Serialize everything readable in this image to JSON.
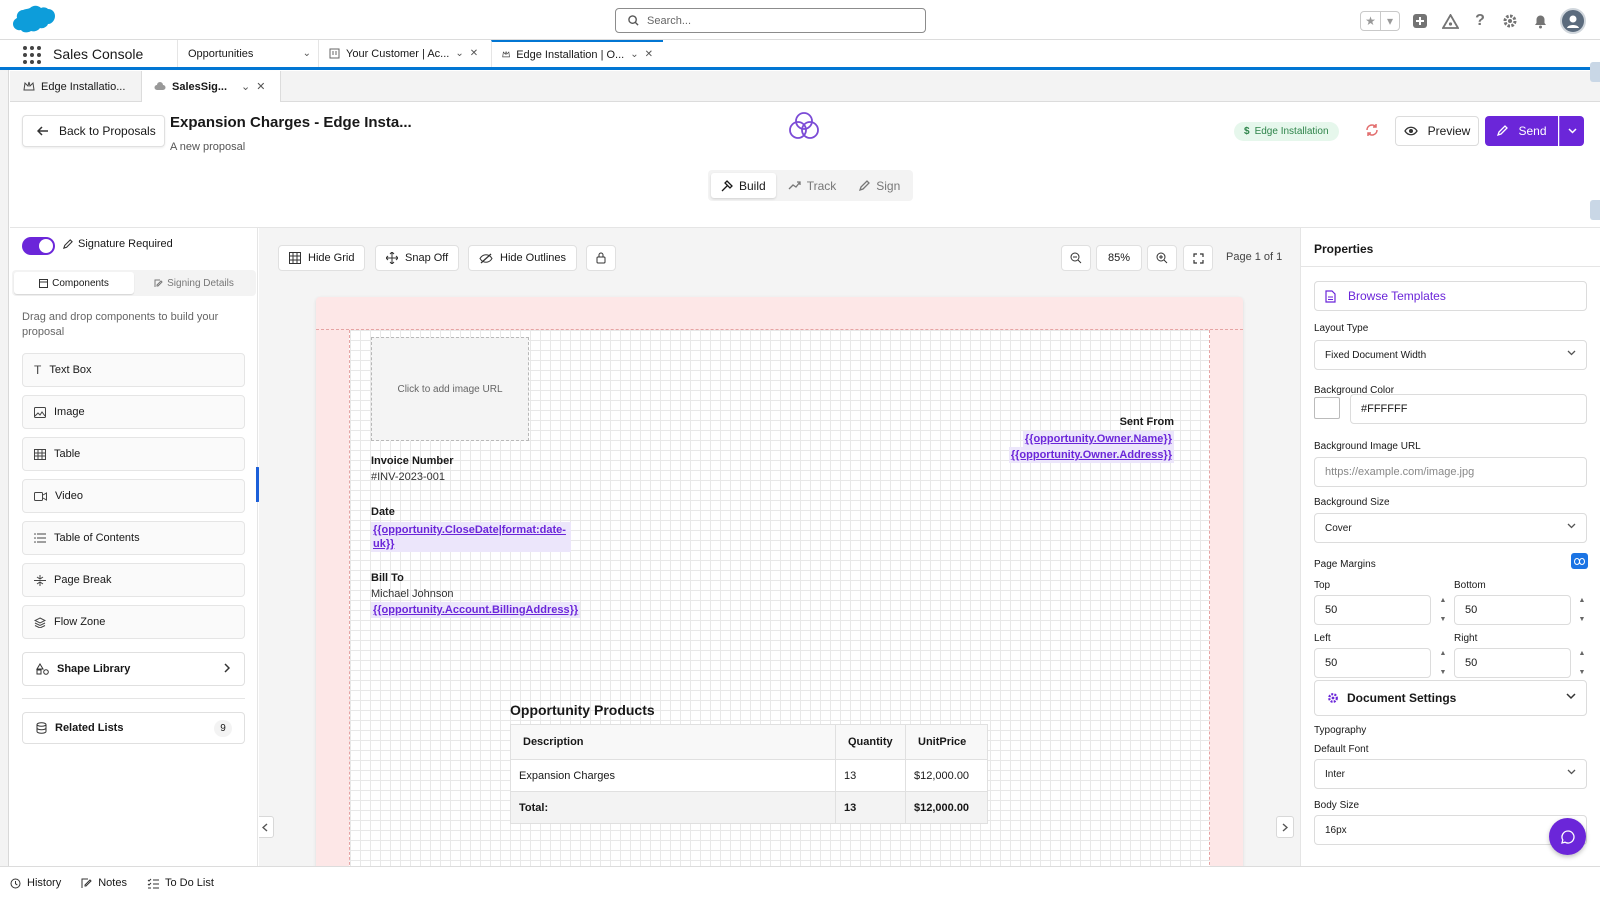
{
  "header": {
    "search_placeholder": "Search..."
  },
  "nav": {
    "app_name": "Sales Console",
    "object_tab": "Opportunities",
    "tabs": [
      {
        "label": "Your Customer | Ac..."
      },
      {
        "label": "Edge Installation | O..."
      }
    ]
  },
  "subtabs": [
    {
      "label": "Edge Installatio..."
    },
    {
      "label": "SalesSig..."
    }
  ],
  "proposal": {
    "back_label": "Back to Proposals",
    "title": "Expansion Charges - Edge Insta...",
    "subtitle": "A new proposal",
    "opportunity_badge": "Edge Installation",
    "preview_label": "Preview",
    "send_label": "Send",
    "modes": [
      "Build",
      "Track",
      "Sign"
    ]
  },
  "left_panel": {
    "signature_label": "Signature Required",
    "signature_required": true,
    "tabs": [
      "Components",
      "Signing Details"
    ],
    "hint": "Drag and drop components to build your proposal",
    "components": [
      "Text Box",
      "Image",
      "Table",
      "Video",
      "Table of Contents",
      "Page Break",
      "Flow Zone"
    ],
    "shape_library": "Shape Library",
    "related_lists": "Related Lists",
    "related_count": "9"
  },
  "toolbar": {
    "hide_grid": "Hide Grid",
    "snap": "Snap Off",
    "hide_outlines": "Hide Outlines",
    "zoom": "85%",
    "page": "Page 1 of 1"
  },
  "document": {
    "image_placeholder": "Click to add image URL",
    "sent_from_label": "Sent From",
    "owner_name": "{{opportunity.Owner.Name}}",
    "owner_address": "{{opportunity.Owner.Address}}",
    "invoice_label": "Invoice Number",
    "invoice_value": "#INV-2023-001",
    "date_label": "Date",
    "date_value": "{{opportunity.CloseDate|format:date-uk}}",
    "bill_label": "Bill To",
    "bill_name": "Michael Johnson",
    "bill_address": "{{opportunity.Account.BillingAddress}}",
    "products_title": "Opportunity Products",
    "table": {
      "headers": [
        "Description",
        "Quantity",
        "UnitPrice"
      ],
      "rows": [
        [
          "Expansion Charges",
          "13",
          "$12,000.00"
        ]
      ],
      "total": [
        "Total:",
        "13",
        "$12,000.00"
      ]
    }
  },
  "properties": {
    "title": "Properties",
    "browse": "Browse Templates",
    "layout_label": "Layout Type",
    "layout_value": "Fixed Document Width",
    "bg_color_label": "Background Color",
    "bg_color_value": "#FFFFFF",
    "bg_image_label": "Background Image URL",
    "bg_image_placeholder": "https://example.com/image.jpg",
    "bg_size_label": "Background Size",
    "bg_size_value": "Cover",
    "margins_label": "Page Margins",
    "top_label": "Top",
    "top_value": "50",
    "bottom_label": "Bottom",
    "bottom_value": "50",
    "left_label": "Left",
    "left_value": "50",
    "right_label": "Right",
    "right_value": "50",
    "doc_settings": "Document Settings",
    "typography": "Typography",
    "default_font_label": "Default Font",
    "default_font_value": "Inter",
    "body_size_label": "Body Size",
    "body_size_value": "16px"
  },
  "utility": [
    "History",
    "Notes",
    "To Do List"
  ],
  "colors": {
    "accent": "#6b26d9",
    "brand": "#0176d3",
    "badge_green": "#2e844a",
    "margin_pink": "#fde7e7"
  }
}
